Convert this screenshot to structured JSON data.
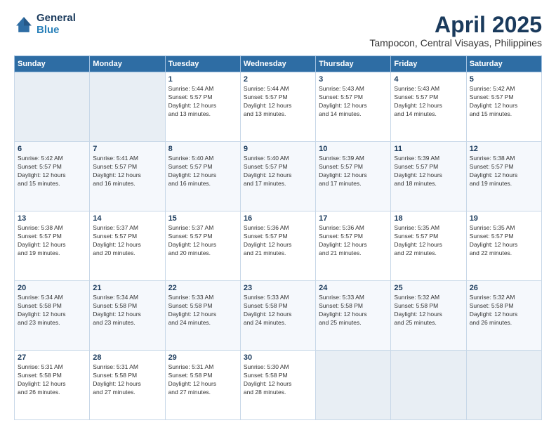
{
  "header": {
    "logo_line1": "General",
    "logo_line2": "Blue",
    "title": "April 2025",
    "subtitle": "Tampocon, Central Visayas, Philippines"
  },
  "weekdays": [
    "Sunday",
    "Monday",
    "Tuesday",
    "Wednesday",
    "Thursday",
    "Friday",
    "Saturday"
  ],
  "weeks": [
    [
      {
        "day": "",
        "info": ""
      },
      {
        "day": "",
        "info": ""
      },
      {
        "day": "1",
        "info": "Sunrise: 5:44 AM\nSunset: 5:57 PM\nDaylight: 12 hours\nand 13 minutes."
      },
      {
        "day": "2",
        "info": "Sunrise: 5:44 AM\nSunset: 5:57 PM\nDaylight: 12 hours\nand 13 minutes."
      },
      {
        "day": "3",
        "info": "Sunrise: 5:43 AM\nSunset: 5:57 PM\nDaylight: 12 hours\nand 14 minutes."
      },
      {
        "day": "4",
        "info": "Sunrise: 5:43 AM\nSunset: 5:57 PM\nDaylight: 12 hours\nand 14 minutes."
      },
      {
        "day": "5",
        "info": "Sunrise: 5:42 AM\nSunset: 5:57 PM\nDaylight: 12 hours\nand 15 minutes."
      }
    ],
    [
      {
        "day": "6",
        "info": "Sunrise: 5:42 AM\nSunset: 5:57 PM\nDaylight: 12 hours\nand 15 minutes."
      },
      {
        "day": "7",
        "info": "Sunrise: 5:41 AM\nSunset: 5:57 PM\nDaylight: 12 hours\nand 16 minutes."
      },
      {
        "day": "8",
        "info": "Sunrise: 5:40 AM\nSunset: 5:57 PM\nDaylight: 12 hours\nand 16 minutes."
      },
      {
        "day": "9",
        "info": "Sunrise: 5:40 AM\nSunset: 5:57 PM\nDaylight: 12 hours\nand 17 minutes."
      },
      {
        "day": "10",
        "info": "Sunrise: 5:39 AM\nSunset: 5:57 PM\nDaylight: 12 hours\nand 17 minutes."
      },
      {
        "day": "11",
        "info": "Sunrise: 5:39 AM\nSunset: 5:57 PM\nDaylight: 12 hours\nand 18 minutes."
      },
      {
        "day": "12",
        "info": "Sunrise: 5:38 AM\nSunset: 5:57 PM\nDaylight: 12 hours\nand 19 minutes."
      }
    ],
    [
      {
        "day": "13",
        "info": "Sunrise: 5:38 AM\nSunset: 5:57 PM\nDaylight: 12 hours\nand 19 minutes."
      },
      {
        "day": "14",
        "info": "Sunrise: 5:37 AM\nSunset: 5:57 PM\nDaylight: 12 hours\nand 20 minutes."
      },
      {
        "day": "15",
        "info": "Sunrise: 5:37 AM\nSunset: 5:57 PM\nDaylight: 12 hours\nand 20 minutes."
      },
      {
        "day": "16",
        "info": "Sunrise: 5:36 AM\nSunset: 5:57 PM\nDaylight: 12 hours\nand 21 minutes."
      },
      {
        "day": "17",
        "info": "Sunrise: 5:36 AM\nSunset: 5:57 PM\nDaylight: 12 hours\nand 21 minutes."
      },
      {
        "day": "18",
        "info": "Sunrise: 5:35 AM\nSunset: 5:57 PM\nDaylight: 12 hours\nand 22 minutes."
      },
      {
        "day": "19",
        "info": "Sunrise: 5:35 AM\nSunset: 5:57 PM\nDaylight: 12 hours\nand 22 minutes."
      }
    ],
    [
      {
        "day": "20",
        "info": "Sunrise: 5:34 AM\nSunset: 5:58 PM\nDaylight: 12 hours\nand 23 minutes."
      },
      {
        "day": "21",
        "info": "Sunrise: 5:34 AM\nSunset: 5:58 PM\nDaylight: 12 hours\nand 23 minutes."
      },
      {
        "day": "22",
        "info": "Sunrise: 5:33 AM\nSunset: 5:58 PM\nDaylight: 12 hours\nand 24 minutes."
      },
      {
        "day": "23",
        "info": "Sunrise: 5:33 AM\nSunset: 5:58 PM\nDaylight: 12 hours\nand 24 minutes."
      },
      {
        "day": "24",
        "info": "Sunrise: 5:33 AM\nSunset: 5:58 PM\nDaylight: 12 hours\nand 25 minutes."
      },
      {
        "day": "25",
        "info": "Sunrise: 5:32 AM\nSunset: 5:58 PM\nDaylight: 12 hours\nand 25 minutes."
      },
      {
        "day": "26",
        "info": "Sunrise: 5:32 AM\nSunset: 5:58 PM\nDaylight: 12 hours\nand 26 minutes."
      }
    ],
    [
      {
        "day": "27",
        "info": "Sunrise: 5:31 AM\nSunset: 5:58 PM\nDaylight: 12 hours\nand 26 minutes."
      },
      {
        "day": "28",
        "info": "Sunrise: 5:31 AM\nSunset: 5:58 PM\nDaylight: 12 hours\nand 27 minutes."
      },
      {
        "day": "29",
        "info": "Sunrise: 5:31 AM\nSunset: 5:58 PM\nDaylight: 12 hours\nand 27 minutes."
      },
      {
        "day": "30",
        "info": "Sunrise: 5:30 AM\nSunset: 5:58 PM\nDaylight: 12 hours\nand 28 minutes."
      },
      {
        "day": "",
        "info": ""
      },
      {
        "day": "",
        "info": ""
      },
      {
        "day": "",
        "info": ""
      }
    ]
  ]
}
